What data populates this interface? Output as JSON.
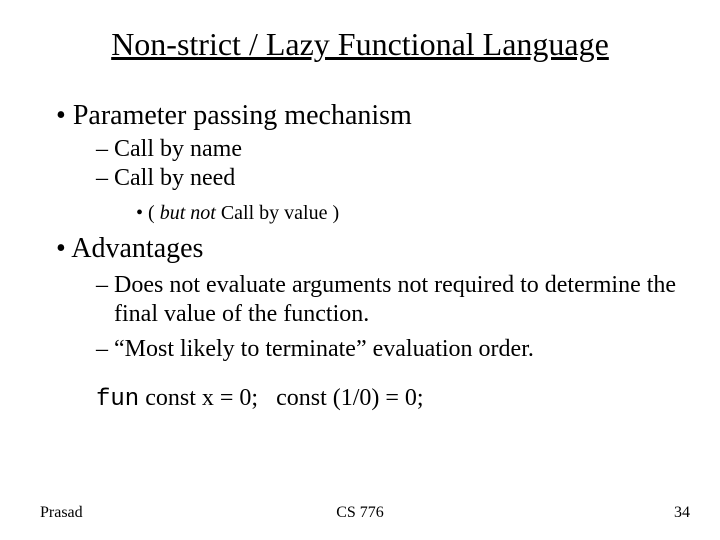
{
  "title": "Non-strict / Lazy Functional Language",
  "bullets": {
    "item1": "Parameter passing mechanism",
    "sub1a": "Call by name",
    "sub1b": "Call by need",
    "sub1c_pre": "( ",
    "sub1c_ital": "but not",
    "sub1c_post": "   Call by value )",
    "item2": "Advantages",
    "sub2a": "Does not evaluate arguments not required to determine the final value of the function.",
    "sub2b": "“Most likely to terminate” evaluation order."
  },
  "code": {
    "kw": "fun",
    "rest": " const x = 0;   const (1/0) = 0;"
  },
  "footer": {
    "left": "Prasad",
    "center": "CS 776",
    "right": "34"
  }
}
